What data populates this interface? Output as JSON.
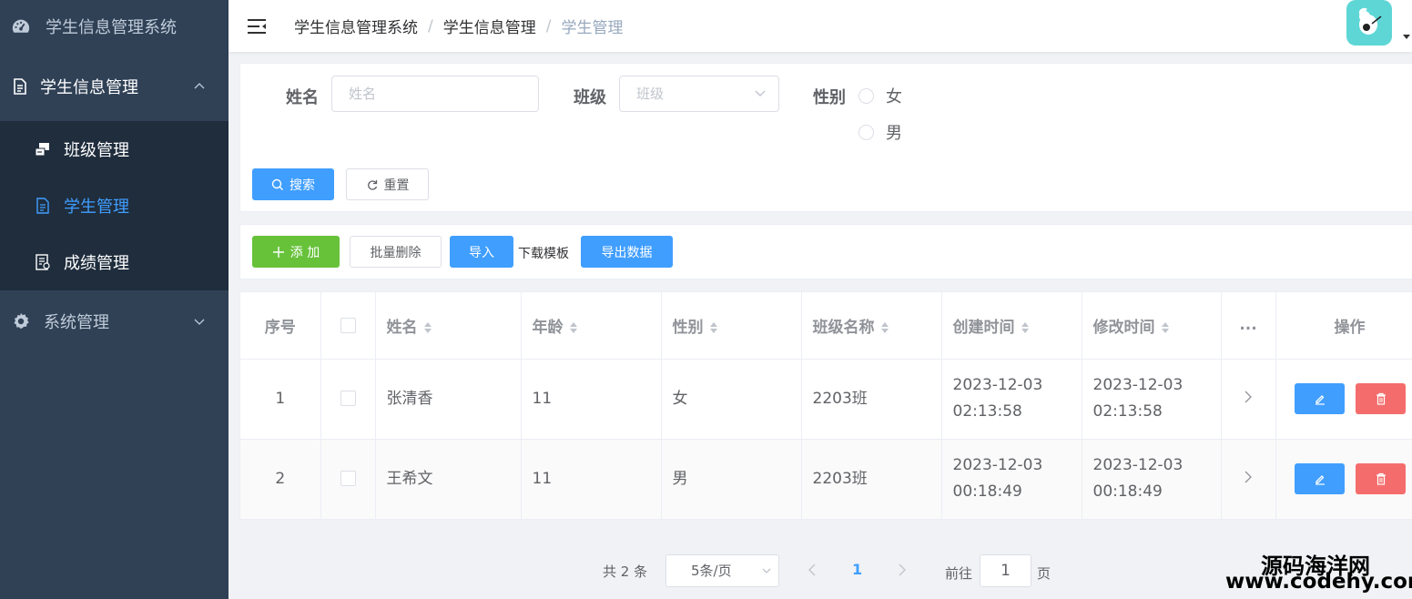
{
  "sidebar": {
    "title": "学生信息管理系统",
    "menu": {
      "label": "学生信息管理",
      "items": [
        {
          "label": "班级管理",
          "active": false
        },
        {
          "label": "学生管理",
          "active": true
        },
        {
          "label": "成绩管理",
          "active": false
        }
      ]
    },
    "system": "系统管理"
  },
  "header": {
    "breadcrumb": [
      "学生信息管理系统",
      "学生信息管理",
      "学生管理"
    ],
    "separator": "/"
  },
  "search": {
    "name_label": "姓名",
    "name_placeholder": "姓名",
    "class_label": "班级",
    "class_placeholder": "班级",
    "gender_label": "性别",
    "gender_options": [
      "女",
      "男"
    ],
    "search_button": "搜索",
    "reset_button": "重置"
  },
  "toolbar": {
    "add": "添 加",
    "batch_delete": "批量删除",
    "import": "导入",
    "download_template": "下载模板",
    "export": "导出数据"
  },
  "table": {
    "headers": {
      "index": "序号",
      "name": "姓名",
      "age": "年龄",
      "gender": "性别",
      "class_name": "班级名称",
      "created": "创建时间",
      "modified": "修改时间",
      "more": "...",
      "actions": "操作"
    },
    "rows": [
      {
        "index": "1",
        "name": "张清香",
        "age": "11",
        "gender": "女",
        "class_name": "2203班",
        "created": "2023-12-03 02:13:58",
        "modified": "2023-12-03 02:13:58"
      },
      {
        "index": "2",
        "name": "王希文",
        "age": "11",
        "gender": "男",
        "class_name": "2203班",
        "created": "2023-12-03 00:18:49",
        "modified": "2023-12-03 00:18:49"
      }
    ]
  },
  "pagination": {
    "total": "共 2 条",
    "page_size": "5条/页",
    "current_page": "1",
    "goto_label": "前往",
    "goto_value": "1",
    "page_label": "页"
  },
  "watermark": {
    "line1": "源码海洋网",
    "line2": "www.codehy.com"
  },
  "colors": {
    "sidebar_bg": "#304156",
    "submenu_bg": "#1f2d3d",
    "primary": "#409eff",
    "success": "#67c23a",
    "danger": "#f56c6c",
    "avatar_bg": "#5fd6d6"
  }
}
